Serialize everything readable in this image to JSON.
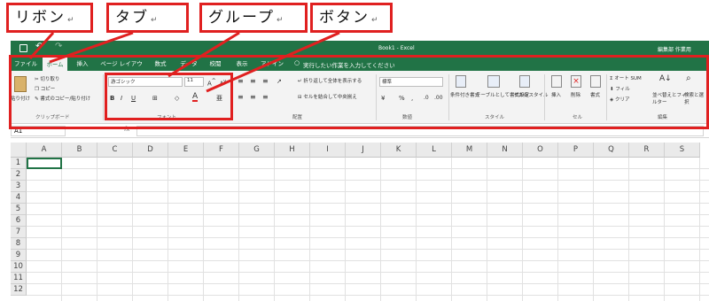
{
  "callouts": {
    "ribbon": "リボン",
    "tab": "タブ",
    "group": "グループ",
    "button": "ボタン",
    "mark": "↵"
  },
  "titlebar": {
    "doc_title": "Book1 - Excel",
    "user": "編集部 作業用"
  },
  "tabs": [
    "ファイル",
    "ホーム",
    "挿入",
    "ページ レイアウト",
    "数式",
    "データ",
    "校閲",
    "表示",
    "アドイン"
  ],
  "tell_me": "実行したい作業を入力してください",
  "ribbon": {
    "clipboard": {
      "paste": "貼り付け",
      "cut": "切り取り",
      "copy": "コピー",
      "format_painter": "書式のコピー/貼り付け",
      "label": "クリップボード"
    },
    "font": {
      "font_name": "游ゴシック",
      "font_size": "11",
      "label": "フォント"
    },
    "alignment": {
      "wrap": "折り返して全体を表示する",
      "merge": "セルを結合して中央揃え",
      "label": "配置"
    },
    "number": {
      "format": "標準",
      "label": "数値"
    },
    "styles": {
      "conditional": "条件付き書式",
      "table": "テーブルとして書式設定",
      "cell": "セルのスタイル",
      "label": "スタイル"
    },
    "cells": {
      "insert": "挿入",
      "delete": "削除",
      "format": "書式",
      "label": "セル"
    },
    "editing": {
      "autosum": "オート SUM",
      "fill": "フィル",
      "clear": "クリア",
      "sort": "並べ替えとフィルター",
      "find": "検索と選択",
      "label": "編集"
    }
  },
  "namebox": "A1",
  "columns": [
    "A",
    "B",
    "C",
    "D",
    "E",
    "F",
    "G",
    "H",
    "I",
    "J",
    "K",
    "L",
    "M",
    "N",
    "O",
    "P",
    "Q",
    "R",
    "S"
  ],
  "rows": [
    "1",
    "2",
    "3",
    "4",
    "5",
    "6",
    "7",
    "8",
    "9",
    "10",
    "11",
    "12"
  ],
  "colors": {
    "excel_green": "#217346",
    "callout_red": "#e02020"
  }
}
